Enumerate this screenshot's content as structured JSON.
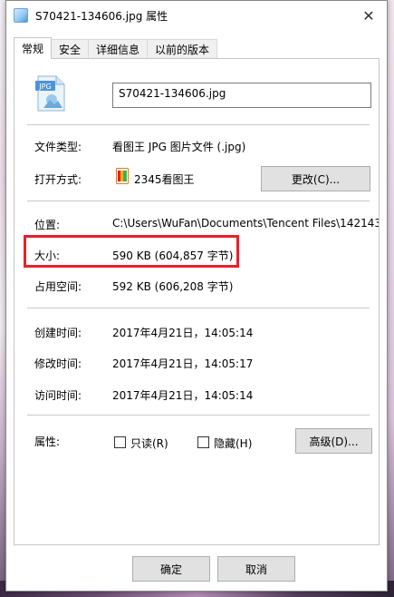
{
  "window": {
    "title": "S70421-134606.jpg 属性",
    "close_glyph": "✕"
  },
  "tabs": [
    {
      "label": "常规",
      "active": true
    },
    {
      "label": "安全",
      "active": false
    },
    {
      "label": "详细信息",
      "active": false
    },
    {
      "label": "以前的版本",
      "active": false
    }
  ],
  "file": {
    "icon_name": "jpg-file-icon",
    "icon_text": "JPG",
    "name": "S70421-134606.jpg"
  },
  "type_row": {
    "label": "文件类型:",
    "value": "看图王 JPG 图片文件 (.jpg)"
  },
  "open_row": {
    "label": "打开方式:",
    "app": "2345看图王",
    "change_button": "更改(C)..."
  },
  "location_row": {
    "label": "位置:",
    "value": "C:\\Users\\WuFan\\Documents\\Tencent Files\\142143"
  },
  "size_row": {
    "label": "大小:",
    "value": "590 KB (604,857 字节)"
  },
  "disk_row": {
    "label": "占用空间:",
    "value": "592 KB (606,208 字节)"
  },
  "created_row": {
    "label": "创建时间:",
    "value": "2017年4月21日，14:05:14"
  },
  "modified_row": {
    "label": "修改时间:",
    "value": "2017年4月21日，14:05:17"
  },
  "accessed_row": {
    "label": "访问时间:",
    "value": "2017年4月21日，14:05:14"
  },
  "attributes": {
    "label": "属性:",
    "readonly": "只读(R)",
    "hidden": "隐藏(H)",
    "advanced_button": "高级(D)..."
  },
  "footer": {
    "ok": "确定",
    "cancel": "取消"
  },
  "colors": {
    "highlight": "#e8202a",
    "accent": "#4d95d4"
  }
}
